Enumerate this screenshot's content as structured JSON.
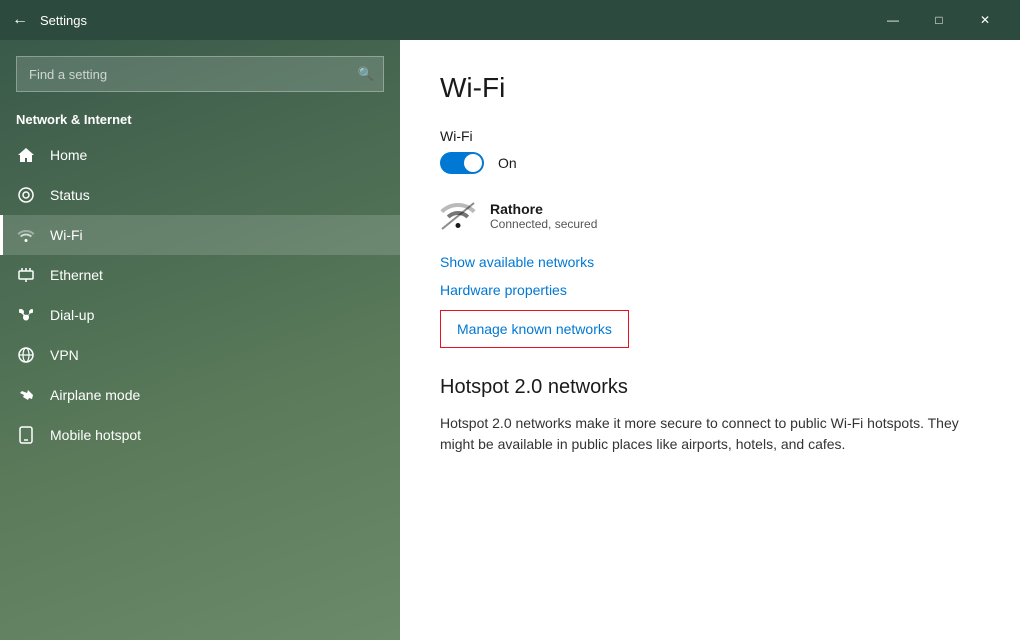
{
  "titlebar": {
    "title": "Settings",
    "back_label": "←",
    "minimize": "—",
    "maximize": "□",
    "close": "✕"
  },
  "sidebar": {
    "search_placeholder": "Find a setting",
    "search_icon": "🔍",
    "category": "Network & Internet",
    "items": [
      {
        "id": "home",
        "label": "Home",
        "icon": "home"
      },
      {
        "id": "status",
        "label": "Status",
        "icon": "status"
      },
      {
        "id": "wifi",
        "label": "Wi-Fi",
        "icon": "wifi",
        "active": true
      },
      {
        "id": "ethernet",
        "label": "Ethernet",
        "icon": "ethernet"
      },
      {
        "id": "dialup",
        "label": "Dial-up",
        "icon": "dialup"
      },
      {
        "id": "vpn",
        "label": "VPN",
        "icon": "vpn"
      },
      {
        "id": "airplane",
        "label": "Airplane mode",
        "icon": "airplane"
      },
      {
        "id": "mobile",
        "label": "Mobile hotspot",
        "icon": "mobile"
      }
    ]
  },
  "content": {
    "page_title": "Wi-Fi",
    "wifi_section_label": "Wi-Fi",
    "toggle_state": "On",
    "network_name": "Rathore",
    "network_status": "Connected, secured",
    "link_show_networks": "Show available networks",
    "link_hardware": "Hardware properties",
    "link_manage": "Manage known networks",
    "hotspot_heading": "Hotspot 2.0 networks",
    "hotspot_description": "Hotspot 2.0 networks make it more secure to connect to public Wi-Fi hotspots. They might be available in public places like airports, hotels, and cafes."
  }
}
